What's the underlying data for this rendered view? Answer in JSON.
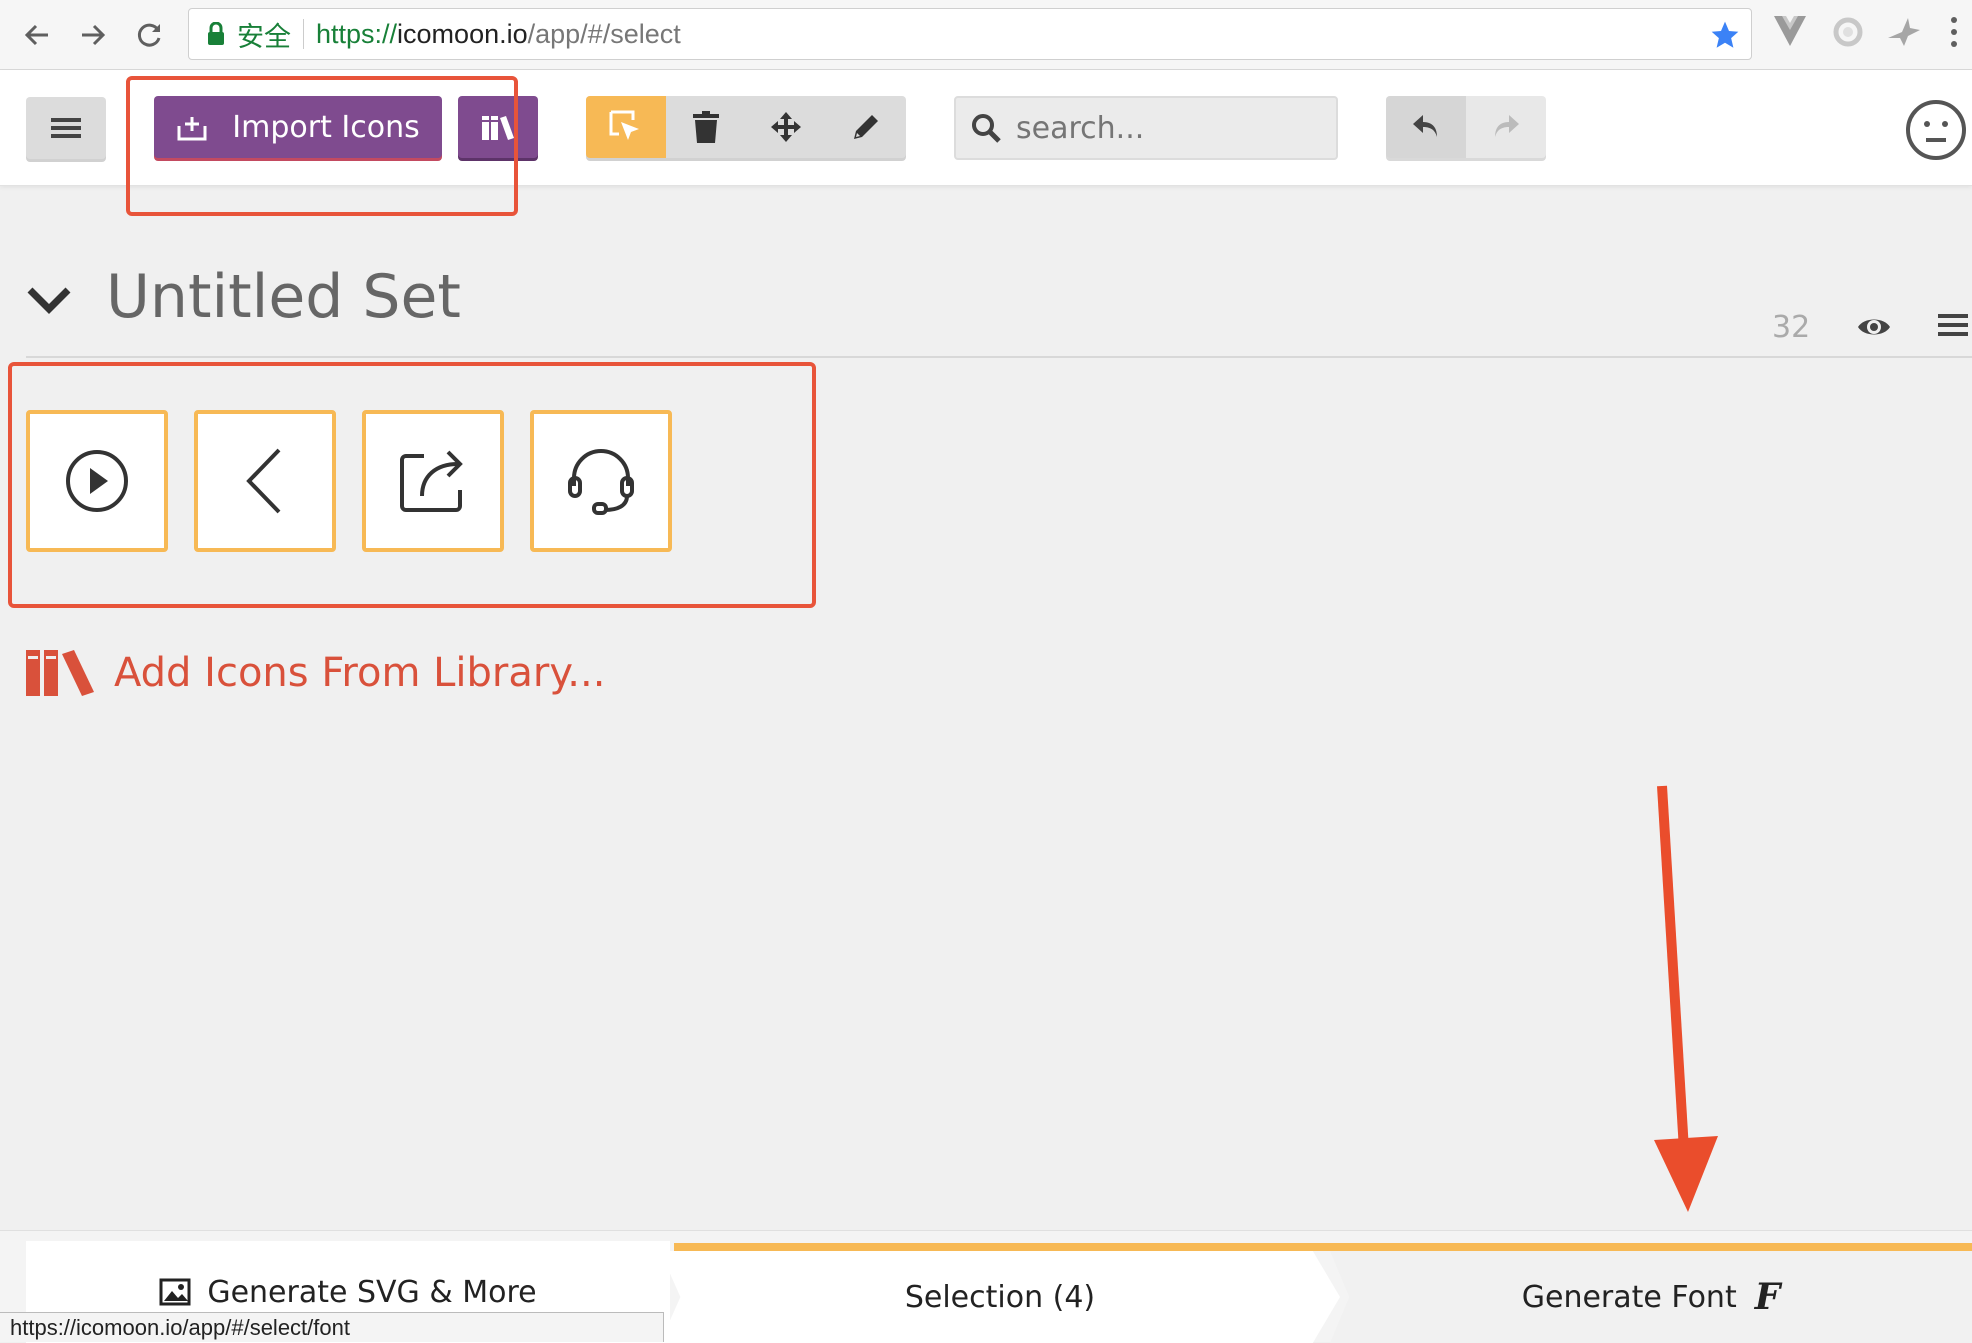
{
  "browser": {
    "secure_label": "安全",
    "url_scheme": "https://",
    "url_host": "icomoon.io",
    "url_path": "/app/#/select"
  },
  "toolbar": {
    "import_label": "Import Icons",
    "search_placeholder": "search..."
  },
  "set": {
    "title": "Untitled Set",
    "icon_count": "32",
    "glyphs": [
      "play-circle",
      "chevron-left",
      "share",
      "headset"
    ]
  },
  "add_library_label": "Add Icons From Library...",
  "bottom": {
    "generate_svg_label": "Generate SVG & More",
    "selection_label": "Selection (4)",
    "generate_font_label": "Generate Font",
    "font_icon_glyph": "F"
  },
  "status_url": "https://icomoon.io/app/#/select/font",
  "colors": {
    "accent_orange": "#f7b955",
    "purple": "#7f4b8f",
    "annotation_red": "#e8543a",
    "library_red": "#d9513b"
  }
}
